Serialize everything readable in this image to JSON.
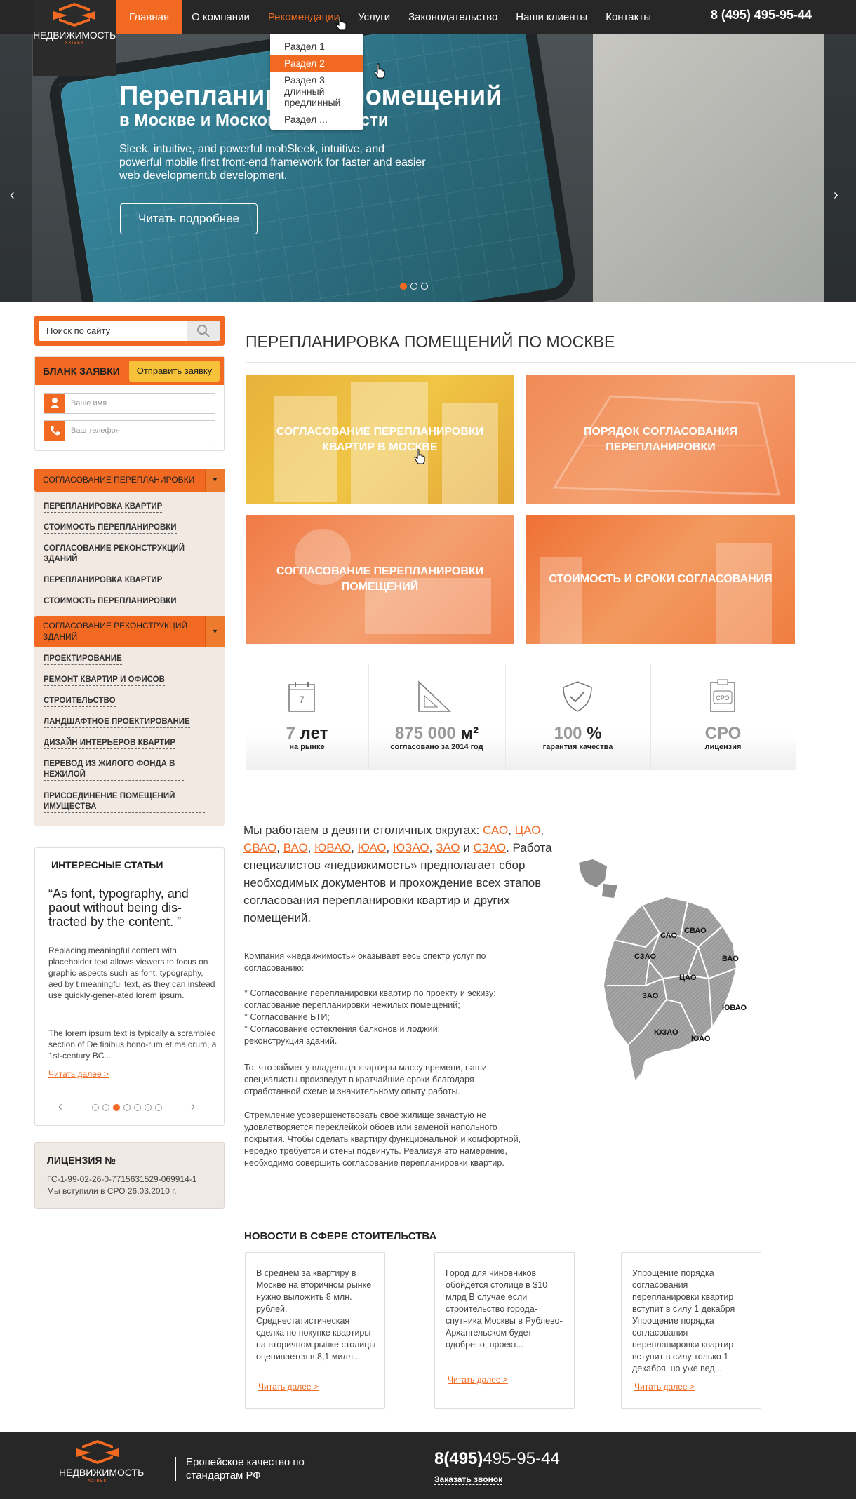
{
  "header": {
    "logo_text": "НЕДВИЖИМОСТЬ",
    "logo_sub": "ХХIВЕК",
    "nav": [
      "Главная",
      "О компании",
      "Рекомендации",
      "Услуги",
      "Законодательство",
      "Наши клиенты",
      "Контакты"
    ],
    "phone": "8 (495) 495-95-44"
  },
  "dropdown": {
    "items": [
      "Раздел 1",
      "Раздел 2",
      "Раздел 3 длинный предлинный",
      "Раздел ..."
    ]
  },
  "hero": {
    "title": "Перепланировка помещений",
    "subtitle": "в Москве и Московской области",
    "description": "Sleek, intuitive, and powerful mobSleek, intuitive, and powerful mobile first front-end framework for faster and easier web development.b development.",
    "button": "Читать подробнее",
    "prev": "‹",
    "next": "›"
  },
  "search": {
    "placeholder": "Поиск по сайту"
  },
  "form": {
    "title": "БЛАНК ЗАЯВКИ",
    "send": "Отправить заявку",
    "name_placeholder": "Ваше имя",
    "phone_placeholder": "Ваш телефон"
  },
  "side_menu": {
    "head1": "СОГЛАСОВАНИЕ ПЕРЕПЛАНИРОВКИ",
    "group1": [
      "ПЕРЕПЛАНИРОВКА КВАРТИР",
      "СТОИМОСТЬ ПЕРЕПЛАНИРОВКИ",
      "СОГЛАСОВАНИЕ РЕКОНСТРУКЦИЙ ЗДАНИЙ",
      "ПЕРЕПЛАНИРОВКА КВАРТИР",
      "СТОИМОСТЬ ПЕРЕПЛАНИРОВКИ"
    ],
    "head2": "СОГЛАСОВАНИЕ РЕКОНСТРУКЦИЙ ЗДАНИЙ",
    "group2": [
      "ПРОЕКТИРОВАНИЕ",
      "РЕМОНТ КВАРТИР И ОФИСОВ",
      "СТРОИТЕЛЬСТВО",
      "ЛАНДШАФТНОЕ ПРОЕКТИРОВАНИЕ",
      "ДИЗАЙН ИНТЕРЬЕРОВ КВАРТИР",
      "ПЕРЕВОД ИЗ ЖИЛОГО ФОНДА В НЕЖИЛОЙ",
      "ПРИСОЕДИНЕНИЕ ПОМЕЩЕНИЙ ИМУЩЕСТВА"
    ]
  },
  "articles": {
    "title": "ИНТЕРЕСНЫЕ СТАТЬИ",
    "quote": "“As font, typography, and paout without being dis-tracted by the content. ”",
    "p1": "Replacing meaningful content with placeholder text allows viewers to focus on graphic aspects such as font, typography, aed by t meaningful text, as they can instead use quickly-gener-ated lorem ipsum.",
    "p2": "The lorem ipsum text is typically a scrambled section of De finibus bono-rum et malorum, a 1st-century BC...",
    "more": "Читать далее >",
    "prev": "‹",
    "next": "›"
  },
  "license": {
    "title": "ЛИЦЕНЗИЯ №",
    "number": "ГС-1-99-02-26-0-7715631529-069914-1",
    "sro": "Мы вступили в СРО 26.03.2010 г."
  },
  "main": {
    "title": "ПЕРЕПЛАНИРОВКА ПОМЕЩЕНИЙ ПО МОСКВЕ",
    "tiles": [
      "СОГЛАСОВАНИЕ ПЕРЕПЛАНИРОВКИ КВАРТИР В МОСКВЕ",
      "ПОРЯДОК СОГЛАСОВАНИЯ ПЕРЕПЛАНИРОВКИ",
      "СОГЛАСОВАНИЕ ПЕРЕПЛАНИРОВКИ ПОМЕЩЕНИЙ",
      "СТОИМОСТЬ И СРОКИ СОГЛАСОВАНИЯ"
    ]
  },
  "stats": [
    {
      "icon_text": "7",
      "value": "7",
      "unit": "лет",
      "label": "на рынке"
    },
    {
      "value": "875 000",
      "unit": "м²",
      "label": "согласовано за 2014 год"
    },
    {
      "value": "100",
      "unit": "%",
      "label": "гарантия качества"
    },
    {
      "icon_text": "СРО",
      "value": "СРО",
      "unit": "",
      "label": "лицензия"
    }
  ],
  "districts": {
    "intro": "Мы работаем в девяти столичных округах:",
    "links": [
      "САО",
      "ЦАО",
      "СВАО",
      "ВАО",
      "ЮВАО",
      "ЮАО",
      "ЮЗАО",
      "ЗАО",
      "СЗАО"
    ],
    "and": "и",
    "text": "Работа специалистов «недвижимость» предполагает сбор необходимых документов и прохождение всех этапов согласования перепланировки квартир и других помещений."
  },
  "body": {
    "p1": "Компания «недвижимость» оказывает весь спектр услуг по согласованию:",
    "items": [
      "° Согласование перепланировки квартир по проекту и эскизу; согласование перепланировки нежилых помещений;",
      "° Согласование БТИ;",
      "° Согласование остекления балконов и лоджий; реконструкция зданий."
    ],
    "p2": "То, что займет у владельца квартиры массу времени, наши специалисты произведут в кратчайшие сроки благодаря отработанной схеме и значительному опыту работы.",
    "p3": "Стремление усовершенствовать свое жилище зачастую не удовлетворяется переклейкой обоев или заменой напольного покрытия. Чтобы сделать квартиру функциональной и комфортной, нередко требуется и стены подвинуть. Реализуя это намерение, необходимо совершить согласование перепланировки квартир."
  },
  "map_labels": [
    "САО",
    "СВАО",
    "СЗАО",
    "ВАО",
    "ЦАО",
    "ЗАО",
    "ЮВАО",
    "ЮЗАО",
    "ЮАО"
  ],
  "news": {
    "title": "НОВОСТИ В СФЕРЕ СТОИТЕЛЬСТВА",
    "items": [
      {
        "text": "В среднем за квартиру в Москве на вторичном рынке нужно выложить 8 млн. рублей. Среднестатистическая сделка по покупке квартиры на вторичном рынке столицы оценивается в 8,1 милл...",
        "more": "Читать далее >"
      },
      {
        "text": "Город для чиновников обойдется столице в $10 млрд В случае если строительство города-спутника Москвы в Рублево-Архангельском будет одобрено, проект...",
        "more": "Читать далее >"
      },
      {
        "text": "Упрощение порядка согласования перепланировки квартир вступит в силу 1 декабря Упрощение порядка согласования перепланировки квартир вступит в силу только 1 декабря, но уже вед...",
        "more": "Читать далее >"
      }
    ]
  },
  "footer": {
    "brand": "НЕДВИЖИМОСТЬ",
    "sub": "ХХIВЕК",
    "slogan": "Еропейское качество по стандартам РФ",
    "phone_code": "8(495)",
    "phone_num": "495-95-44",
    "call": "Заказать звонок"
  },
  "colors": {
    "accent": "#f26a21",
    "dark": "#272727",
    "yellow": "#f7c23a",
    "menu_bg": "#f3e9e3"
  }
}
